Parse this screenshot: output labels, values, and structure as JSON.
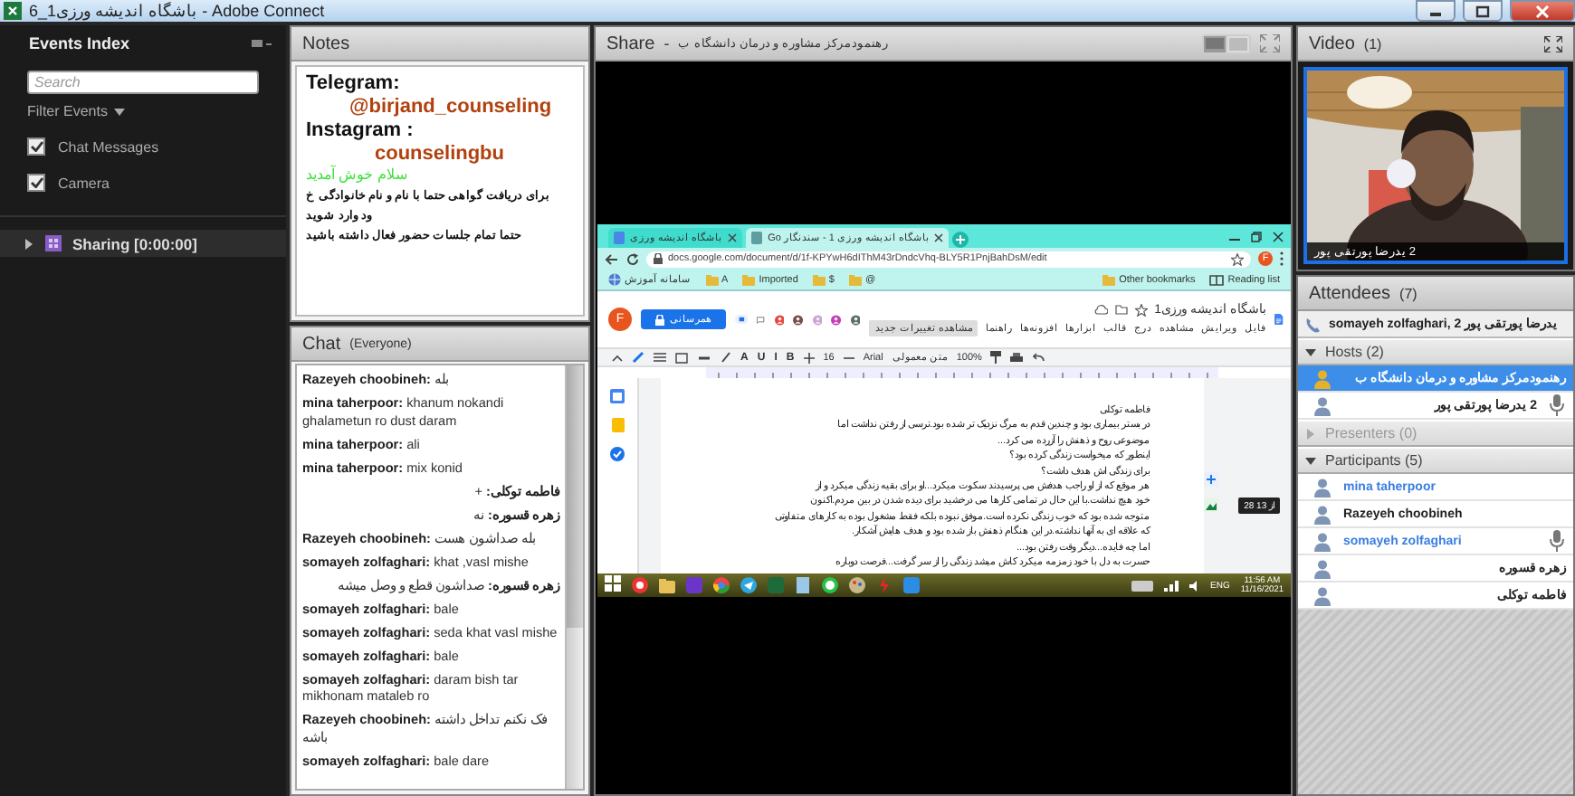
{
  "window": {
    "title": "باشگاه اندیشه ورزی1_6 - Adobe Connect"
  },
  "events_index": {
    "title": "Events Index",
    "search": {
      "placeholder": "Search"
    },
    "filter": "Filter Events",
    "filters": [
      {
        "label": "Chat Messages",
        "checked": true
      },
      {
        "label": "Camera",
        "checked": true
      }
    ],
    "items": [
      {
        "label": "Sharing [0:00:00]",
        "expanded": false
      }
    ]
  },
  "notes": {
    "title": "Notes",
    "lines": [
      {
        "kind": "heading",
        "text": "Telegram:"
      },
      {
        "kind": "handle",
        "text": "@birjand_counseling"
      },
      {
        "kind": "heading",
        "text": "Instagram :"
      },
      {
        "kind": "handle",
        "text": "counselingbu"
      },
      {
        "kind": "greeting",
        "text": "سلام خوش آمدید"
      },
      {
        "kind": "body",
        "text": "برای دریافت گواهی حتما با نام و نام خانوادگی خ"
      },
      {
        "kind": "body",
        "text": "ود وارد شوید"
      },
      {
        "kind": "body",
        "text": "حتما تمام جلسات حضور فعال داشته باشید"
      }
    ]
  },
  "chat": {
    "title": "Chat",
    "audience": "(Everyone)",
    "messages": [
      {
        "sender": "Razeyeh choobineh:",
        "text": "بله"
      },
      {
        "sender": "mina taherpoor:",
        "text": "khanum nokandi ghalametun ro dust daram"
      },
      {
        "sender": "mina taherpoor:",
        "text": "ali"
      },
      {
        "sender": "mina taherpoor:",
        "text": "mix konid"
      },
      {
        "sender": "فاطمه توکلی:",
        "text": "+"
      },
      {
        "sender": "زهره قسوره:",
        "text": "نه"
      },
      {
        "sender": "Razeyeh choobineh:",
        "text": "بله صداشون هست"
      },
      {
        "sender": "somayeh zolfaghari:",
        "text": "khat ,vasl mishe"
      },
      {
        "sender": "زهره قسوره:",
        "text": "صداشون قطع و وصل میشه"
      },
      {
        "sender": "somayeh zolfaghari:",
        "text": "bale"
      },
      {
        "sender": "somayeh zolfaghari:",
        "text": "seda khat vasl mishe"
      },
      {
        "sender": "somayeh zolfaghari:",
        "text": "bale"
      },
      {
        "sender": "somayeh zolfaghari:",
        "text": "daram bish tar mikhonam mataleb ro"
      },
      {
        "sender": "Razeyeh choobineh:",
        "text": "فک نکنم تداخل داشته باشه"
      },
      {
        "sender": "somayeh zolfaghari:",
        "text": "bale dare"
      }
    ]
  },
  "share": {
    "title": "Share",
    "separator": "-",
    "presenter": "رهنمودمرکز مشاوره و درمان دانشگاه ب",
    "view_buttons": [
      {
        "selected": true
      },
      {
        "selected": false
      }
    ],
    "screen": {
      "tabs": [
        {
          "label": "باشگاه اندیشه ورزی 1 - سندنگار Go",
          "selected": true
        },
        {
          "label": "باشگاه اندیشه ورزی",
          "selected": false
        }
      ],
      "url": "docs.google.com/document/d/1f-KPYwH6dIThM43rDndcVhq-BLY5R1PnjBahDsM/edit",
      "profile": "F",
      "doc_profile": "F",
      "bookmarks": [
        {
          "kind": "folder",
          "label": "@"
        },
        {
          "kind": "folder",
          "label": "$"
        },
        {
          "kind": "folder",
          "label": "Imported"
        },
        {
          "kind": "folder",
          "label": "A"
        },
        {
          "kind": "site",
          "label": "سامانه آموزش"
        }
      ],
      "other_bookmarks": "Other bookmarks",
      "reading_list": "Reading list",
      "doc_title": "باشگاه اندیشه ورزی1",
      "share_button": "همرسانی",
      "notice": "مشاهده تغییرات جدید",
      "menu": [
        "فایل",
        "ویرایش",
        "مشاهده",
        "درج",
        "قالب",
        "ابزارها",
        "افزونه‌ها",
        "راهنما"
      ],
      "format_buttons": [
        "B",
        "I",
        "U",
        "A"
      ],
      "font_size": "16",
      "font": "Arial",
      "style": "متن معمولی",
      "zoom": "100%",
      "lines": [
        "فاطمه توکلی",
        "در بستر بیماری بود و چندین قدم به مرگ نزدیک تر شده بود.ترسی از رفتن نداشت اما",
        "موضوعی روح و ذهنش را آزرده می کرد...",
        "اینطور که میخواست زندگی کرده بود؟",
        "برای زندگی اش هدف داشت؟",
        "هر موقع که از او راجب هدفش می پرسیدند سکوت میکرد...او برای بقیه زندگی میکرد و از",
        "خود هیچ نداشت.با این حال در تمامی کارها می درخشید برای دیده شدن در بین مردم.اکنون",
        "متوجه شده بود که خوب زندگی نکرده است.موفق نبوده بلکه فقط مشغول بوده به کارهای متفاوتی",
        "که علاقه ای به آنها نداشته.در این هنگام ذهنش باز شده بود و هدف هایش آشکار.",
        "اما چه فایده...دیگر وقت رفتن بود...",
        "حسرت به دل با خود زمزمه میکرد کاش میشد زندگی را از سر گرفت...فرصت دوباره"
      ],
      "page_badge": "28 از 13",
      "language": "ENG",
      "time": "11:56 AM",
      "date": "11/16/2021"
    }
  },
  "video": {
    "title": "Video",
    "count": "(1)",
    "caption": "2 یدرضا پورتقی پور"
  },
  "attendees": {
    "title": "Attendees",
    "count": "(7)",
    "speaking": "somayeh zolfaghari, 2 یدرضا پورتقی پور",
    "groups": [
      {
        "label": "Hosts (2)",
        "expanded": true,
        "disabled": false,
        "members": [
          {
            "name": "رهنمودمرکز مشاوره و درمان دانشگاه ب",
            "selected": true,
            "active": false,
            "mic": false
          },
          {
            "name": "2 یدرضا پورتقی پور",
            "selected": false,
            "active": false,
            "mic": true
          }
        ]
      },
      {
        "label": "Presenters (0)",
        "expanded": false,
        "disabled": true
      },
      {
        "label": "Participants (5)",
        "expanded": true,
        "disabled": false,
        "members": [
          {
            "name": "mina taherpoor",
            "selected": false,
            "active": true,
            "mic": false
          },
          {
            "name": "Razeyeh choobineh",
            "selected": false,
            "active": false,
            "mic": false
          },
          {
            "name": "somayeh zolfaghari",
            "selected": false,
            "active": true,
            "mic": true
          },
          {
            "name": "زهره قسوره",
            "selected": false,
            "active": false,
            "mic": false
          },
          {
            "name": "فاطمه توکلی",
            "selected": false,
            "active": false,
            "mic": false
          }
        ]
      }
    ]
  }
}
